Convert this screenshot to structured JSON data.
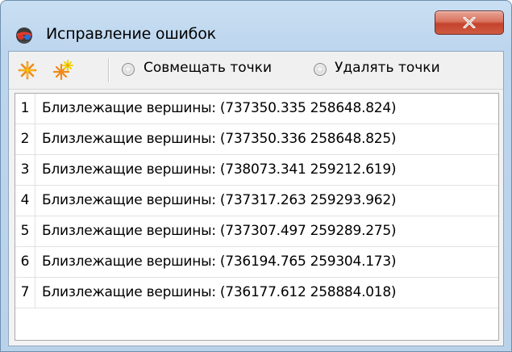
{
  "window": {
    "title": "Исправление ошибок",
    "close_label": "X"
  },
  "toolbar": {
    "tools": [
      {
        "icon": "asterisk-orange-icon"
      },
      {
        "icon": "asterisk-multi-icon"
      }
    ],
    "radios": [
      {
        "label": "Совмещать точки",
        "checked": false
      },
      {
        "label": "Удалять точки",
        "checked": false
      }
    ]
  },
  "list": {
    "rows": [
      {
        "num": "1",
        "text": "Близлежащие вершины: (737350.335 258648.824)"
      },
      {
        "num": "2",
        "text": "Близлежащие вершины: (737350.336 258648.825)"
      },
      {
        "num": "3",
        "text": "Близлежащие вершины: (738073.341 259212.619)"
      },
      {
        "num": "4",
        "text": "Близлежащие вершины: (737317.263 259293.962)"
      },
      {
        "num": "5",
        "text": "Близлежащие вершины: (737307.497 259289.275)"
      },
      {
        "num": "6",
        "text": "Близлежащие вершины: (736194.765 259304.173)"
      },
      {
        "num": "7",
        "text": "Близлежащие вершины: (736177.612 258884.018)"
      }
    ]
  }
}
